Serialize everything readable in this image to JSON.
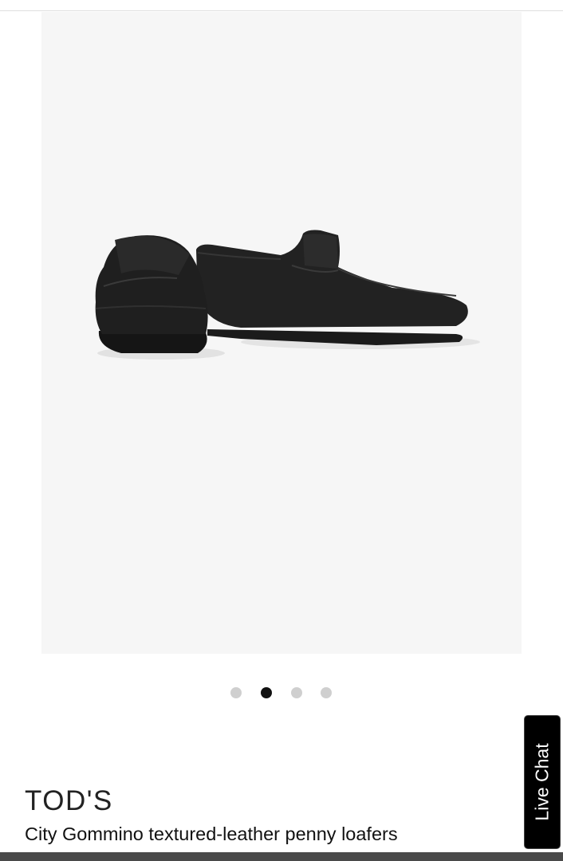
{
  "gallery": {
    "image_alt": "Black textured-leather penny loafers, pair view",
    "slide_count": 4,
    "active_slide": 2
  },
  "product": {
    "brand": "TOD'S",
    "name": "City Gommino textured-leather penny loafers"
  },
  "live_chat": {
    "label": "Live Chat"
  },
  "colors": {
    "image_background": "#f6f6f6",
    "dot_inactive": "#cfcfcf",
    "dot_active": "#111111",
    "chat_background": "#000000"
  }
}
